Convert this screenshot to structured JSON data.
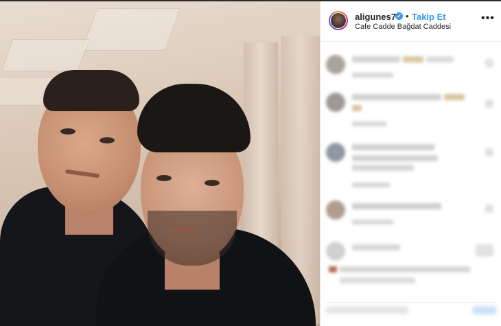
{
  "post": {
    "username": "aligunes7",
    "verified_mark": "✔",
    "separator": "•",
    "follow_label": "Takip Et",
    "location": "Cafe Cadde Bağdat Caddesi",
    "more_label": "•••"
  },
  "photo": {
    "description_icon": "selfie-photo"
  },
  "colors": {
    "accent": "#3897f0",
    "text": "#262626"
  }
}
